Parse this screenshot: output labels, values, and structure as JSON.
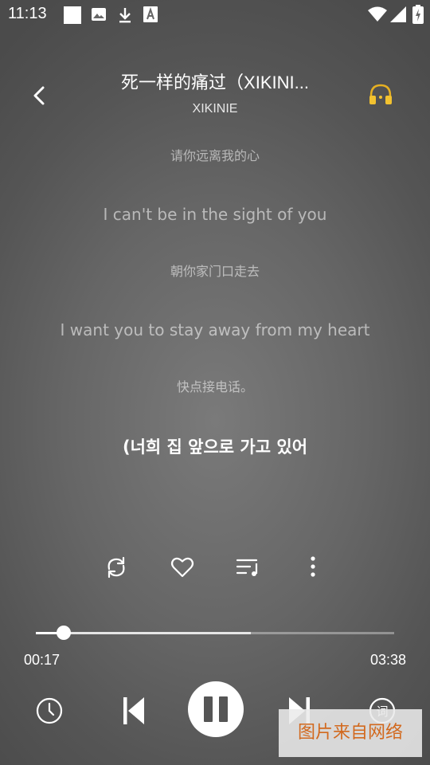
{
  "status_bar": {
    "time": "11:13",
    "icons": [
      "notification-square-icon",
      "image-icon",
      "download-icon",
      "font-a-icon",
      "wifi-icon",
      "signal-icon",
      "battery-charging-icon"
    ]
  },
  "header": {
    "title": "死一样的痛过（XIKINI...",
    "artist": "XIKINIE",
    "accent_color": "#f2c230"
  },
  "lyrics": [
    {
      "text": "请你远离我的心",
      "state": "past"
    },
    {
      "text": "I can't be in the sight of you",
      "state": "past"
    },
    {
      "text": "朝你家门口走去",
      "state": "past"
    },
    {
      "text": "I want you to stay away from my heart",
      "state": "past"
    },
    {
      "text": "快点接电话。",
      "state": "past"
    },
    {
      "text": "(너희 집 앞으로 가고 있어",
      "state": "current"
    }
  ],
  "actions": [
    "repeat-icon",
    "heart-icon",
    "playlist-icon",
    "more-vertical-icon"
  ],
  "progress": {
    "elapsed": "00:17",
    "duration": "03:38",
    "played_fraction": 0.078,
    "buffered_fraction": 0.6
  },
  "controls": [
    "timer-icon",
    "previous-icon",
    "pause-icon",
    "next-icon",
    "lyrics-icon"
  ],
  "lyrics_button_glyph": "词",
  "watermark": "图片来自网络"
}
